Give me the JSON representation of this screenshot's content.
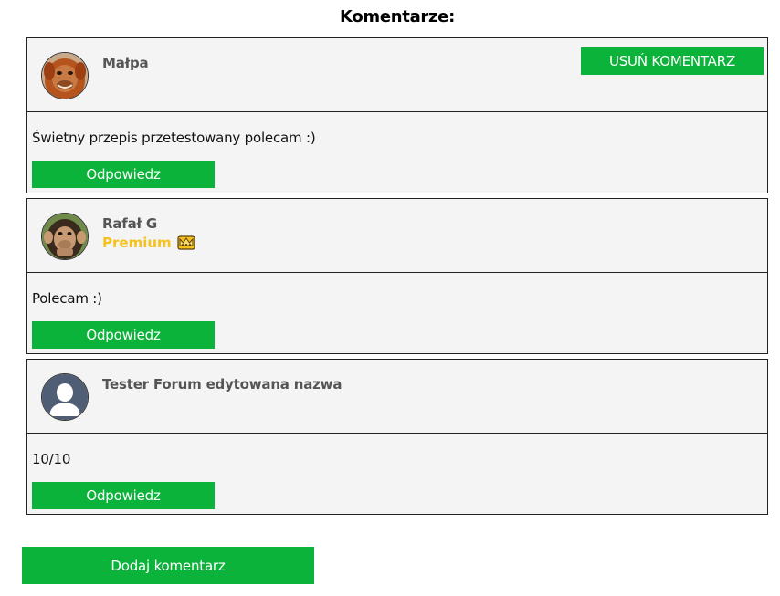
{
  "page": {
    "heading": "Komentarze:",
    "add_comment_label": "Dodaj komentarz"
  },
  "comments": [
    {
      "author": "Małpa",
      "avatar": "orangutan-avatar",
      "premium_label": null,
      "delete_label": "USUŃ KOMENTARZ",
      "text": "Świetny przepis przetestowany polecam :)",
      "reply_label": "Odpowiedz"
    },
    {
      "author": "Rafał G",
      "avatar": "chimpanzee-avatar",
      "premium_label": "Premium",
      "premium_icon": "crown-icon",
      "text": "Polecam :)",
      "reply_label": "Odpowiedz"
    },
    {
      "author": "Tester Forum edytowana nazwa",
      "avatar": "default-user-avatar",
      "premium_label": null,
      "text": "10/10",
      "reply_label": "Odpowiedz"
    }
  ],
  "colors": {
    "accent_green": "#0cb33a",
    "premium_gold": "#f4c21b",
    "card_bg": "#f4f4f4"
  }
}
